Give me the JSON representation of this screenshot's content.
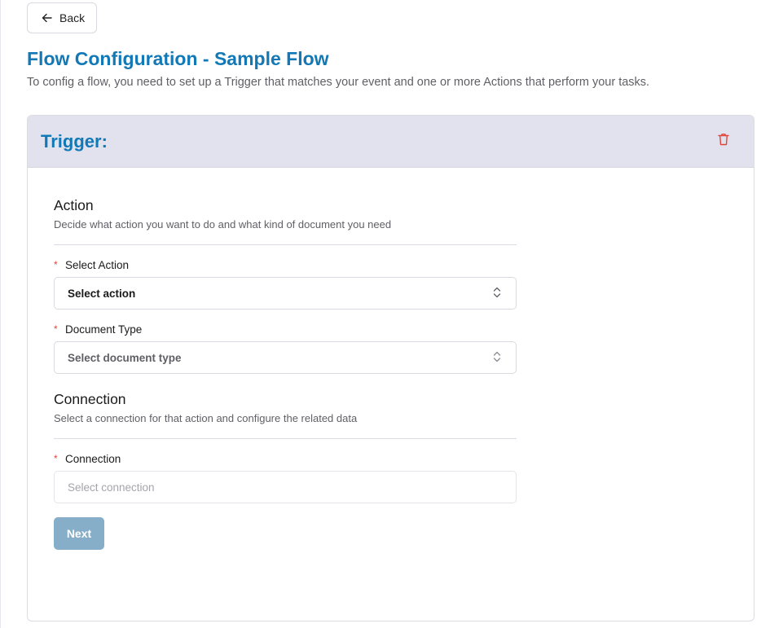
{
  "header": {
    "back_label": "Back",
    "title": "Flow Configuration - Sample Flow",
    "description": "To config a flow, you need to set up a Trigger that matches your event and one or more Actions that perform your tasks."
  },
  "card": {
    "title": "Trigger:"
  },
  "action_section": {
    "title": "Action",
    "description": "Decide what action you want to do and what kind of document you need",
    "select_action": {
      "label": "Select Action",
      "required_mark": "*",
      "value": "Select action"
    },
    "document_type": {
      "label": "Document Type",
      "required_mark": "*",
      "value": "Select document type"
    }
  },
  "connection_section": {
    "title": "Connection",
    "description": "Select a connection for that action and configure the related data",
    "connection": {
      "label": "Connection",
      "required_mark": "*",
      "placeholder": "Select connection"
    }
  },
  "next_label": "Next",
  "colors": {
    "accent": "#1278b6",
    "header_bg": "#e2e2ee",
    "delete": "#e0453c",
    "next_bg": "#86aec9",
    "required": "#e0453c"
  },
  "icons": {
    "back": "arrow-left-icon",
    "delete": "trash-icon",
    "select": "chevron-up-down-icon"
  }
}
